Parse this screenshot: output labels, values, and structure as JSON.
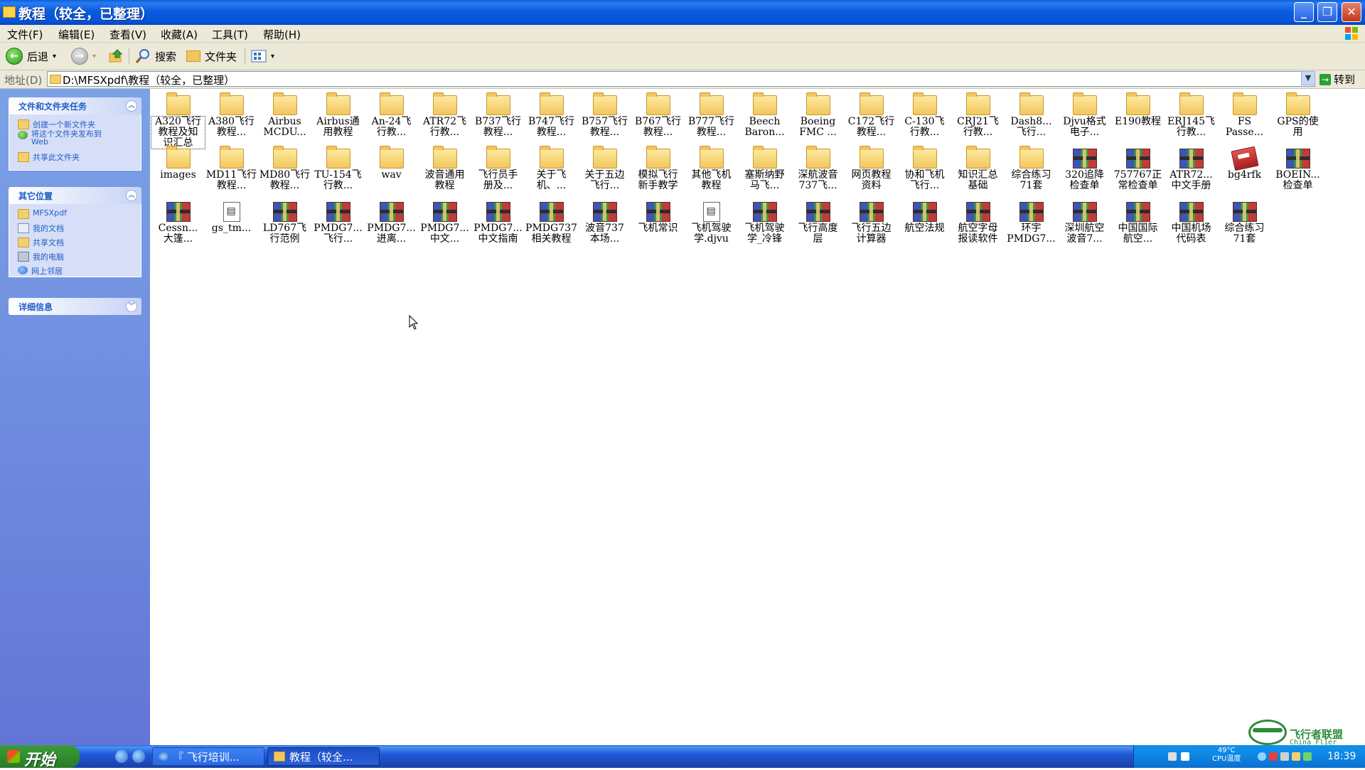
{
  "window": {
    "title": "教程（较全，已整理）",
    "controls": {
      "minimize": "_",
      "maximize": "❐",
      "close": "✕"
    }
  },
  "menu": [
    "文件(F)",
    "编辑(E)",
    "查看(V)",
    "收藏(A)",
    "工具(T)",
    "帮助(H)"
  ],
  "toolbar": {
    "back": "后退",
    "search": "搜索",
    "folders": "文件夹"
  },
  "address": {
    "label": "地址(D)",
    "path": "D:\\MFSXpdf\\教程（较全，已整理）",
    "go": "转到"
  },
  "sidebar": {
    "tasks_title": "文件和文件夹任务",
    "tasks": [
      "创建一个新文件夹",
      "将这个文件夹发布到\nWeb",
      "共享此文件夹"
    ],
    "places_title": "其它位置",
    "places": [
      "MFSXpdf",
      "我的文档",
      "共享文档",
      "我的电脑",
      "网上邻居"
    ],
    "details_title": "详细信息"
  },
  "items": [
    {
      "label": "A320飞行\n教程及知\n识汇总",
      "type": "folder"
    },
    {
      "label": "A380飞行\n教程...",
      "type": "folder"
    },
    {
      "label": "Airbus\nMCDU...",
      "type": "folder"
    },
    {
      "label": "Airbus通\n用教程",
      "type": "folder"
    },
    {
      "label": "An-24飞\n行教...",
      "type": "folder"
    },
    {
      "label": "ATR72飞\n行教...",
      "type": "folder"
    },
    {
      "label": "B737飞行\n教程...",
      "type": "folder"
    },
    {
      "label": "B747飞行\n教程...",
      "type": "folder"
    },
    {
      "label": "B757飞行\n教程...",
      "type": "folder"
    },
    {
      "label": "B767飞行\n教程...",
      "type": "folder"
    },
    {
      "label": "B777飞行\n教程...",
      "type": "folder"
    },
    {
      "label": "Beech\nBaron...",
      "type": "folder"
    },
    {
      "label": "Boeing\nFMC ...",
      "type": "folder"
    },
    {
      "label": "C172飞行\n教程...",
      "type": "folder"
    },
    {
      "label": "C-130飞\n行教...",
      "type": "folder"
    },
    {
      "label": "CRJ21飞\n行教...",
      "type": "folder"
    },
    {
      "label": "Dash8...\n飞行...",
      "type": "folder"
    },
    {
      "label": "Djvu格式\n电子...",
      "type": "folder"
    },
    {
      "label": "E190教程",
      "type": "folder"
    },
    {
      "label": "ERJ145飞\n行教...",
      "type": "folder"
    },
    {
      "label": "FS\nPasse...",
      "type": "folder"
    },
    {
      "label": "GPS的使\n用",
      "type": "folder"
    },
    {
      "label": "images",
      "type": "folder"
    },
    {
      "label": "MD11飞行\n教程...",
      "type": "folder"
    },
    {
      "label": "MD80飞行\n教程...",
      "type": "folder"
    },
    {
      "label": "TU-154飞\n行教...",
      "type": "folder"
    },
    {
      "label": "wav",
      "type": "folder"
    },
    {
      "label": "波音通用\n教程",
      "type": "folder"
    },
    {
      "label": "飞行员手\n册及...",
      "type": "folder"
    },
    {
      "label": "关于飞\n机、...",
      "type": "folder"
    },
    {
      "label": "关于五边\n飞行...",
      "type": "folder"
    },
    {
      "label": "模拟飞行\n新手教学",
      "type": "folder"
    },
    {
      "label": "其他飞机\n教程",
      "type": "folder"
    },
    {
      "label": "塞斯纳野\n马飞...",
      "type": "folder"
    },
    {
      "label": "深航波音\n737飞...",
      "type": "folder"
    },
    {
      "label": "网页教程\n资料",
      "type": "folder"
    },
    {
      "label": "协和飞机\n飞行...",
      "type": "folder"
    },
    {
      "label": "知识汇总\n基础",
      "type": "folder"
    },
    {
      "label": "综合练习\n71套",
      "type": "folder"
    },
    {
      "label": "320追降\n检查单",
      "type": "rar"
    },
    {
      "label": "757767正\n常检查单",
      "type": "rar"
    },
    {
      "label": "ATR72...\n中文手册",
      "type": "rar"
    },
    {
      "label": "bg4rfk",
      "type": "book"
    },
    {
      "label": "BOEIN...\n检查单",
      "type": "rar"
    },
    {
      "label": "Cessn...\n大篷...",
      "type": "rar"
    },
    {
      "label": "gs_tm...",
      "type": "doc"
    },
    {
      "label": "LD767飞\n行范例",
      "type": "rar"
    },
    {
      "label": "PMDG7...\n飞行...",
      "type": "rar"
    },
    {
      "label": "PMDG7...\n进离...",
      "type": "rar"
    },
    {
      "label": "PMDG7...\n中文...",
      "type": "rar"
    },
    {
      "label": "PMDG7...\n中文指南",
      "type": "rar"
    },
    {
      "label": "PMDG737\n相关教程",
      "type": "rar"
    },
    {
      "label": "波音737\n本场...",
      "type": "rar"
    },
    {
      "label": "飞机常识",
      "type": "rar"
    },
    {
      "label": "飞机驾驶\n学.djvu",
      "type": "doc"
    },
    {
      "label": "飞机驾驶\n学_冷锋",
      "type": "rar"
    },
    {
      "label": "飞行高度\n层",
      "type": "rar"
    },
    {
      "label": "飞行五边\n计算器",
      "type": "rar"
    },
    {
      "label": "航空法规",
      "type": "rar"
    },
    {
      "label": "航空字母\n报读软件",
      "type": "rar"
    },
    {
      "label": "环宇\nPMDG7...",
      "type": "rar"
    },
    {
      "label": "深圳航空\n波音7...",
      "type": "rar"
    },
    {
      "label": "中国国际\n航空...",
      "type": "rar"
    },
    {
      "label": "中国机场\n代码表",
      "type": "rar"
    },
    {
      "label": "综合练习\n71套",
      "type": "rar"
    }
  ],
  "taskbar": {
    "start": "开始",
    "buttons": [
      "『 飞行培训...",
      "教程（较全..."
    ],
    "cpu_temp": "49°C",
    "cpu_label": "CPU温度",
    "clock": "18:39"
  },
  "watermark": {
    "cn": "飞行者联盟",
    "en": "China Flier"
  }
}
